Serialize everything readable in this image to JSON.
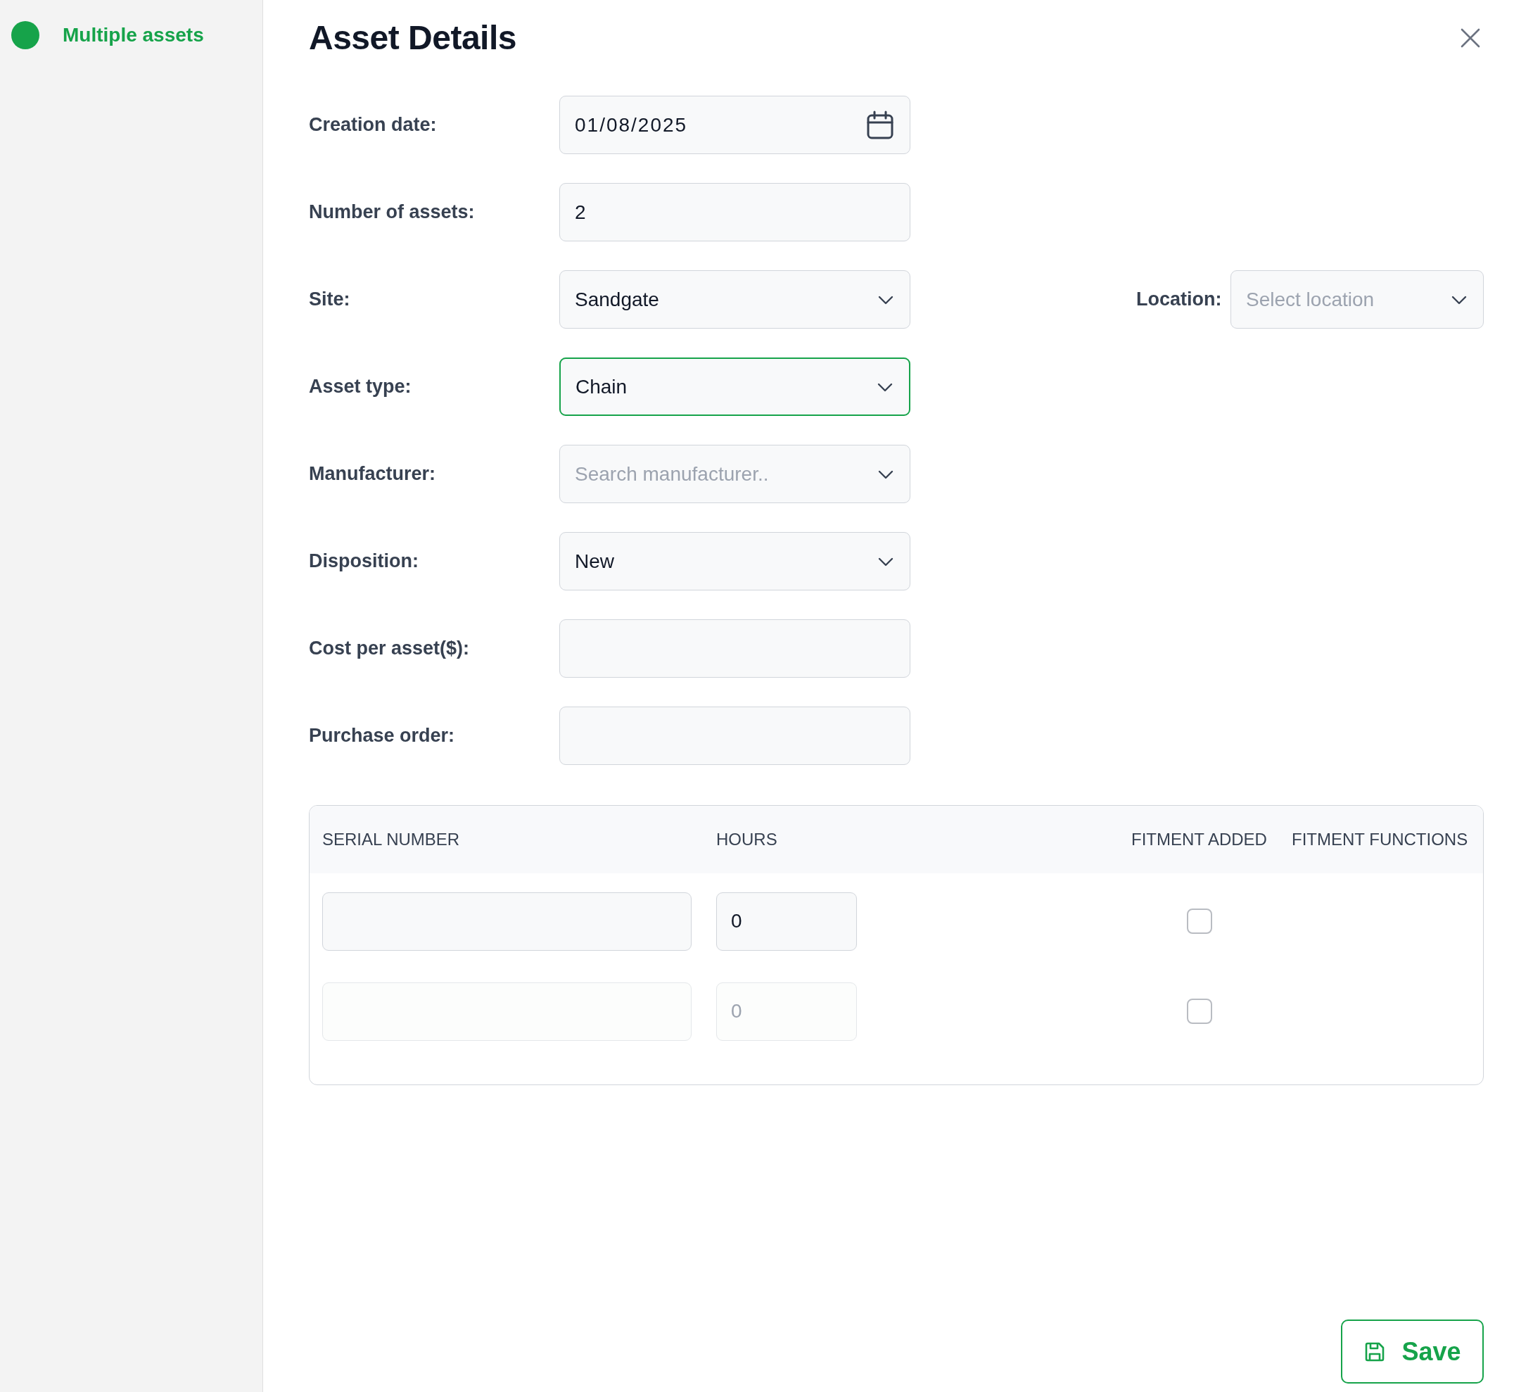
{
  "sidebar": {
    "items": [
      {
        "label": "Multiple assets",
        "selected": true,
        "color": "#16a34a"
      }
    ]
  },
  "panel": {
    "title": "Asset Details"
  },
  "form": {
    "rows": [
      {
        "fields": [
          {
            "label": "Creation date:",
            "kind": "date",
            "value": "01/08/2025",
            "focused": false
          }
        ]
      },
      {
        "fields": [
          {
            "label": "Number of assets:",
            "kind": "text",
            "value": "2",
            "focused": false
          }
        ]
      },
      {
        "fields": [
          {
            "label": "Site:",
            "kind": "select",
            "value": "Sandgate",
            "focused": false
          },
          {
            "label": "Location:",
            "kind": "select",
            "placeholder": "Select location",
            "focused": false
          }
        ]
      },
      {
        "fields": [
          {
            "label": "Asset type:",
            "kind": "select",
            "value": "Chain",
            "focused": true
          }
        ]
      },
      {
        "fields": [
          {
            "label": "Manufacturer:",
            "kind": "select",
            "placeholder": "Search manufacturer..",
            "focused": false
          }
        ]
      },
      {
        "fields": [
          {
            "label": "Disposition:",
            "kind": "select",
            "value": "New",
            "focused": false
          }
        ]
      },
      {
        "fields": [
          {
            "label": "Cost per asset($):",
            "kind": "text",
            "focused": false
          }
        ]
      },
      {
        "fields": [
          {
            "label": "Purchase order:",
            "kind": "text",
            "focused": false
          }
        ]
      }
    ]
  },
  "table": {
    "columns": [
      "SERIAL NUMBER",
      "HOURS",
      "FITMENT ADDED",
      "FITMENT FUNCTIONS"
    ],
    "rows": [
      {
        "hours": "0",
        "fitment_added": false,
        "disabled": false
      },
      {
        "hours": "0",
        "fitment_added": false,
        "disabled": true
      }
    ]
  },
  "save_button": {
    "label": "Save"
  }
}
